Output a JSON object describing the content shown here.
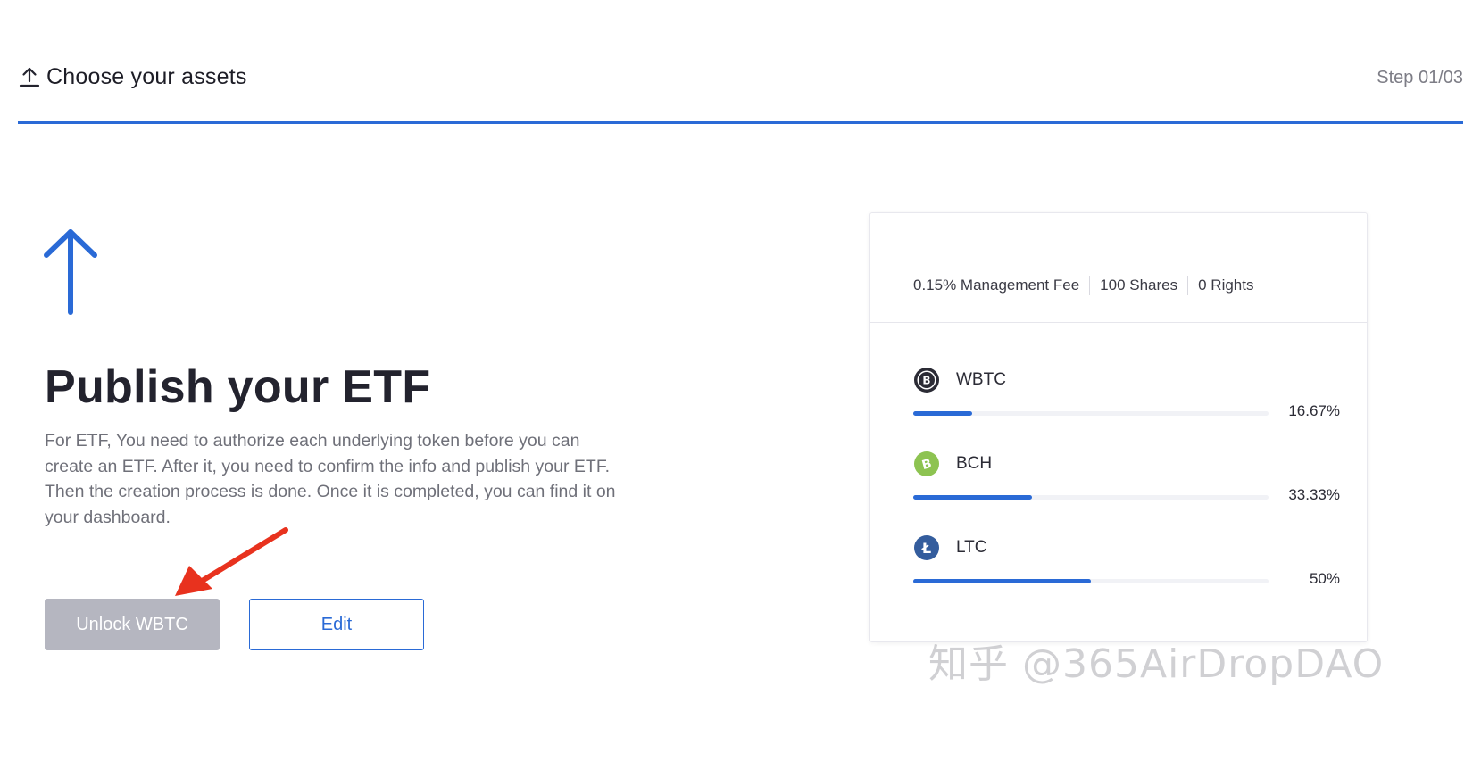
{
  "header": {
    "title": "Choose your assets",
    "step": "Step 01/03"
  },
  "main": {
    "heading": "Publish your ETF",
    "description": "For ETF, You need to authorize each underlying token before you can create an ETF. After it, you need to confirm the info and publish your ETF. Then the creation process is done. Once it is completed, you can find it on your dashboard.",
    "unlock_label": "Unlock WBTC",
    "edit_label": "Edit"
  },
  "card": {
    "management_fee": "0.15% Management Fee",
    "shares": "100 Shares",
    "rights": "0 Rights",
    "assets": [
      {
        "name": "WBTC",
        "percent_label": "16.67%",
        "fraction": 0.1667,
        "icon": "wbtc-icon",
        "color": "#2b2b35"
      },
      {
        "name": "BCH",
        "percent_label": "33.33%",
        "fraction": 0.3333,
        "icon": "bch-icon",
        "color": "#8dc351"
      },
      {
        "name": "LTC",
        "percent_label": "50%",
        "fraction": 0.5,
        "icon": "ltc-icon",
        "color": "#345d9d"
      }
    ]
  },
  "colors": {
    "accent": "#2a6ad6",
    "button_disabled": "#b5b6c0",
    "annotation": "#e8321e"
  },
  "watermark": "知乎 @365AirDropDAO"
}
